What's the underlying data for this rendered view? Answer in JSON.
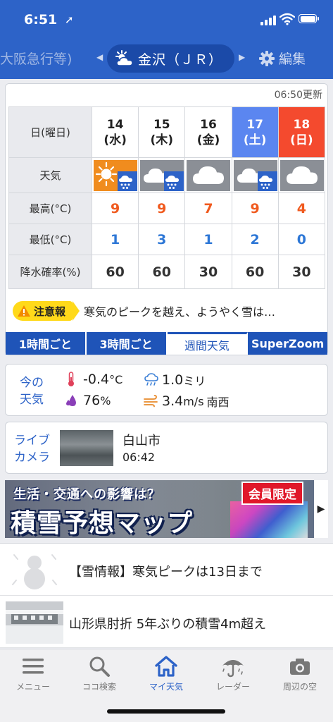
{
  "status_bar": {
    "time": "6:51",
    "location_arrow": "➚"
  },
  "location_nav": {
    "prev_location": "大阪急行等)",
    "current_location": "金沢（ＪＲ）",
    "current_weather_icon": "sun-cloud-icon",
    "edit_label": "編集"
  },
  "forecast": {
    "updated": "06:50更新",
    "row_headers": {
      "date": "日(曜日)",
      "weather": "天気",
      "high": "最高(°C)",
      "low": "最低(°C)",
      "precip": "降水確率(%)"
    },
    "days": [
      {
        "date": "14",
        "weekday": "(水)",
        "type": "weekday",
        "icon": "sun-snow-icon",
        "high": "9",
        "low": "1",
        "precip": "60"
      },
      {
        "date": "15",
        "weekday": "(木)",
        "type": "weekday",
        "icon": "cloud-snow-icon",
        "high": "9",
        "low": "3",
        "precip": "60"
      },
      {
        "date": "16",
        "weekday": "(金)",
        "type": "weekday",
        "icon": "cloud-icon",
        "high": "7",
        "low": "1",
        "precip": "30"
      },
      {
        "date": "17",
        "weekday": "(土)",
        "type": "saturday",
        "icon": "cloud-snow-icon",
        "high": "9",
        "low": "2",
        "precip": "60"
      },
      {
        "date": "18",
        "weekday": "(日)",
        "type": "sunday",
        "icon": "cloud-icon",
        "high": "4",
        "low": "0",
        "precip": "30"
      }
    ],
    "alert": {
      "label": "注意報",
      "text": "寒気のピークを越え、ようやく雪は…"
    },
    "tabs": [
      "1時間ごと",
      "3時間ごと",
      "週間天気",
      "SuperZoom"
    ],
    "active_tab": "週間天気"
  },
  "current_weather": {
    "label_line1": "今の",
    "label_line2": "天気",
    "temperature": "-0.4",
    "temperature_unit": "°C",
    "humidity": "76",
    "humidity_unit": "%",
    "precip_amount": "1.0",
    "precip_unit": "ミリ",
    "wind_speed": "3.4",
    "wind_unit": "m/s",
    "wind_dir": "南西"
  },
  "live_camera": {
    "label_line1": "ライブ",
    "label_line2": "カメラ",
    "place": "白山市",
    "time": "06:42"
  },
  "banner": {
    "subtitle": "生活・交通への影響は？",
    "title": "積雪予想マップ",
    "badge": "会員限定"
  },
  "news": [
    {
      "title": "【雪情報】寒気ピークは13日まで",
      "thumb": "snowman-icon"
    },
    {
      "title": "山形県肘折 5年ぶりの積雪4m超え",
      "thumb": "snow-photo"
    }
  ],
  "bottom_nav": [
    {
      "label": "メニュー",
      "icon": "menu-icon"
    },
    {
      "label": "ココ検索",
      "icon": "search-icon"
    },
    {
      "label": "マイ天気",
      "icon": "home-icon",
      "active": true
    },
    {
      "label": "レーダー",
      "icon": "umbrella-icon"
    },
    {
      "label": "周辺の空",
      "icon": "camera-icon"
    }
  ],
  "colors": {
    "brand_blue": "#2d63c8",
    "saturday": "#5b86f0",
    "sunday": "#f44a2e",
    "high_temp": "#f05a1e",
    "low_temp": "#2d77d6",
    "alert_yellow": "#ffd91a",
    "sun_bg": "#f08c1e",
    "cloud_bg": "#8b8f96",
    "snow_badge": "#2d63c8"
  }
}
